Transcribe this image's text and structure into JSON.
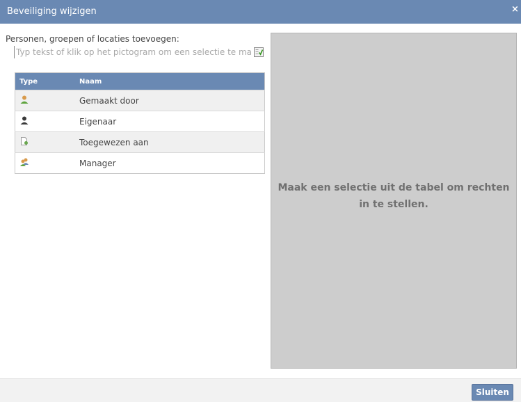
{
  "dialog": {
    "title": "Beveiliging wijzigen",
    "close_glyph": "×"
  },
  "add_principals": {
    "label": "Personen, groepen of locaties toevoegen:",
    "placeholder": "Typ tekst of klik op het pictogram om een selectie te maken",
    "value": "",
    "picker_icon": "address-book-check-icon"
  },
  "table": {
    "headers": {
      "type": "Type",
      "name": "Naam"
    },
    "rows": [
      {
        "icon": "created-by-user-icon",
        "name": "Gemaakt door"
      },
      {
        "icon": "owner-user-icon",
        "name": "Eigenaar"
      },
      {
        "icon": "assigned-document-icon",
        "name": "Toegewezen aan"
      },
      {
        "icon": "manager-users-icon",
        "name": "Manager"
      }
    ]
  },
  "right_pane": {
    "hint_line1": "Maak een selectie uit de tabel om rechten",
    "hint_line2": "in te stellen."
  },
  "footer": {
    "close_label": "Sluiten"
  },
  "colors": {
    "accent": "#6a89b3",
    "right_pane_bg": "#cdcdcd",
    "row_alt_bg": "#f0f0f0"
  }
}
